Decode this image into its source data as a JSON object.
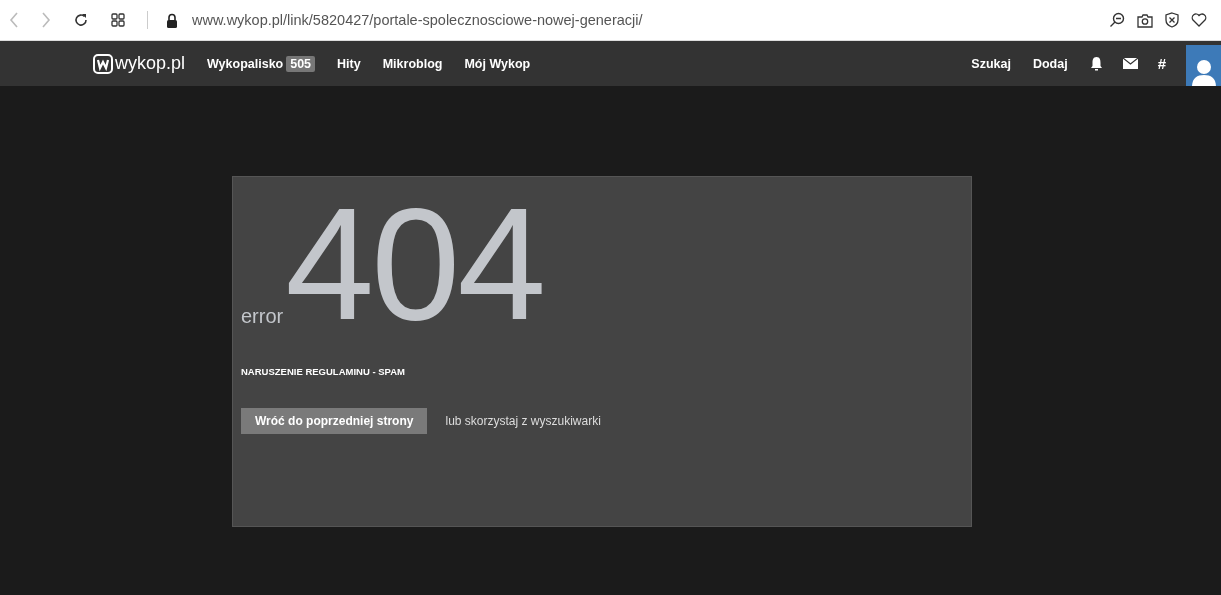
{
  "browser": {
    "url": "www.wykop.pl/link/5820427/portale-spolecznosciowe-nowej-generacji/"
  },
  "nav": {
    "logo": "wykop.pl",
    "items": [
      {
        "label": "Wykopalisko",
        "badge": "505"
      },
      {
        "label": "Hity"
      },
      {
        "label": "Mikroblog"
      },
      {
        "label": "Mój Wykop"
      }
    ],
    "right_items": [
      {
        "label": "Szukaj"
      },
      {
        "label": "Dodaj"
      }
    ],
    "hash": "#"
  },
  "error": {
    "code": "404",
    "word": "error",
    "reason": "NARUSZENIE REGULAMINU - SPAM",
    "button": "Wróć do poprzedniej strony",
    "alt_text": "lub skorzystaj z wyszukiwarki"
  }
}
